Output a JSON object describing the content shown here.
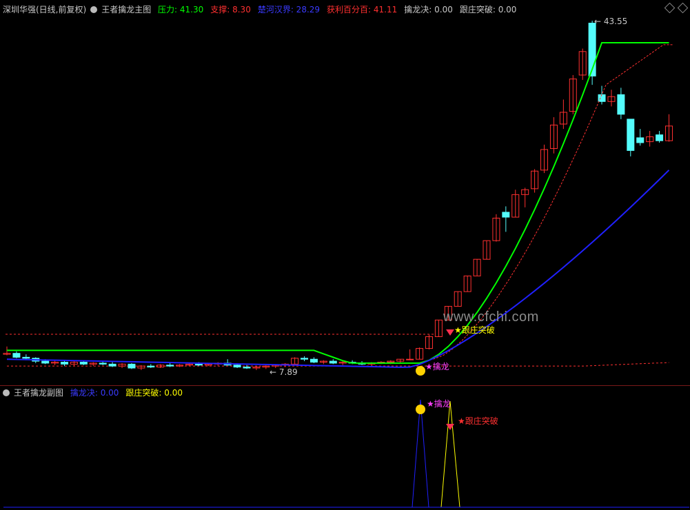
{
  "main_panel": {
    "symbol_title": "深圳华强(日线,前复权)",
    "indicator_name": "王者擒龙主图",
    "readouts": [
      {
        "label": "压力",
        "value": "41.30",
        "color": "#00ff00"
      },
      {
        "label": "支撑",
        "value": "8.30",
        "color": "#ff3030"
      },
      {
        "label": "楚河汉界",
        "value": "28.29",
        "color": "#3a3aff"
      },
      {
        "label": "获利百分百",
        "value": "41.11",
        "color": "#ff3030"
      },
      {
        "label": "擒龙决",
        "value": "0.00",
        "color": "#c8c8c8"
      },
      {
        "label": "跟庄突破",
        "value": "0.00",
        "color": "#c8c8c8"
      }
    ],
    "high_marker": "43.55",
    "low_marker": "7.89",
    "signal_qinlong": "★擒龙",
    "signal_breakout": "★跟庄突破"
  },
  "sub_panel": {
    "indicator_name": "王者擒龙副图",
    "readouts": [
      {
        "label": "擒龙决",
        "value": "0.00",
        "color": "#3a3aff"
      },
      {
        "label": "跟庄突破",
        "value": "0.00",
        "color": "#ffff00"
      }
    ],
    "signal_qinlong": "★擒龙",
    "signal_breakout": "★跟庄突破"
  },
  "watermark": "www.cfchi.com",
  "colors": {
    "up": "#ff3030",
    "down": "#54fcfc",
    "pressure": "#00ff00",
    "support": "#ff3030",
    "boundary": "#2020ff",
    "profit": "#ff3030"
  },
  "chart_data": {
    "type": "candlestick",
    "price_range": [
      7.89,
      43.55
    ],
    "candles_ohlc": [
      [
        9.5,
        10.3,
        9.4,
        9.6
      ],
      [
        9.6,
        9.8,
        9.1,
        9.2
      ],
      [
        9.2,
        9.5,
        8.9,
        9.1
      ],
      [
        9.1,
        9.2,
        8.6,
        8.8
      ],
      [
        8.8,
        9.0,
        8.5,
        8.6
      ],
      [
        8.6,
        8.9,
        8.4,
        8.7
      ],
      [
        8.7,
        8.9,
        8.3,
        8.5
      ],
      [
        8.5,
        8.8,
        8.3,
        8.7
      ],
      [
        8.7,
        8.8,
        8.4,
        8.5
      ],
      [
        8.5,
        8.7,
        8.3,
        8.6
      ],
      [
        8.6,
        8.8,
        8.4,
        8.5
      ],
      [
        8.5,
        8.7,
        8.2,
        8.3
      ],
      [
        8.3,
        8.6,
        8.1,
        8.5
      ],
      [
        8.5,
        8.6,
        8.0,
        8.1
      ],
      [
        8.1,
        8.4,
        7.9,
        8.3
      ],
      [
        8.3,
        8.5,
        8.1,
        8.2
      ],
      [
        8.2,
        8.5,
        8.1,
        8.4
      ],
      [
        8.4,
        8.6,
        8.2,
        8.3
      ],
      [
        8.3,
        8.5,
        8.2,
        8.4
      ],
      [
        8.4,
        8.6,
        8.3,
        8.5
      ],
      [
        8.5,
        8.7,
        8.3,
        8.4
      ],
      [
        8.4,
        8.6,
        8.3,
        8.5
      ],
      [
        8.5,
        8.7,
        8.3,
        8.6
      ],
      [
        8.6,
        9.0,
        8.4,
        8.4
      ],
      [
        8.4,
        8.6,
        8.1,
        8.2
      ],
      [
        8.2,
        8.4,
        8.0,
        8.1
      ],
      [
        8.1,
        8.3,
        7.89,
        8.2
      ],
      [
        8.2,
        8.4,
        8.0,
        8.3
      ],
      [
        8.3,
        8.5,
        8.1,
        8.4
      ],
      [
        8.4,
        8.6,
        8.2,
        8.5
      ],
      [
        8.5,
        9.2,
        8.4,
        9.1
      ],
      [
        9.1,
        9.3,
        8.8,
        9.0
      ],
      [
        9.0,
        9.2,
        8.6,
        8.7
      ],
      [
        8.7,
        8.9,
        8.5,
        8.8
      ],
      [
        8.8,
        9.0,
        8.5,
        8.6
      ],
      [
        8.6,
        8.8,
        8.4,
        8.7
      ],
      [
        8.7,
        8.9,
        8.5,
        8.6
      ],
      [
        8.6,
        8.8,
        8.4,
        8.5
      ],
      [
        8.5,
        8.7,
        8.3,
        8.6
      ],
      [
        8.6,
        8.8,
        8.5,
        8.7
      ],
      [
        8.7,
        8.9,
        8.5,
        8.8
      ],
      [
        8.8,
        9.0,
        8.6,
        9.0
      ],
      [
        9.0,
        10.0,
        8.9,
        9.0
      ],
      [
        9.0,
        10.2,
        9.0,
        10.1
      ],
      [
        10.1,
        11.5,
        10.0,
        11.3
      ],
      [
        11.3,
        13.0,
        11.3,
        13.0
      ],
      [
        13.0,
        14.4,
        13.0,
        14.4
      ],
      [
        14.4,
        15.9,
        14.4,
        15.9
      ],
      [
        15.9,
        17.5,
        15.9,
        17.5
      ],
      [
        17.5,
        19.2,
        17.5,
        19.2
      ],
      [
        19.2,
        21.1,
        19.2,
        21.1
      ],
      [
        21.1,
        23.8,
        21.0,
        23.4
      ],
      [
        24.0,
        24.6,
        22.0,
        23.5
      ],
      [
        23.5,
        26.3,
        23.5,
        25.8
      ],
      [
        25.8,
        26.5,
        24.5,
        26.3
      ],
      [
        26.4,
        28.4,
        26.0,
        28.2
      ],
      [
        28.3,
        30.9,
        28.0,
        30.4
      ],
      [
        30.5,
        33.7,
        30.0,
        32.9
      ],
      [
        33.0,
        35.5,
        32.5,
        34.2
      ],
      [
        34.3,
        38.0,
        34.0,
        37.6
      ],
      [
        38.0,
        40.7,
        37.5,
        40.4
      ],
      [
        43.3,
        43.55,
        37.0,
        37.9
      ],
      [
        36.0,
        36.9,
        35.0,
        35.3
      ],
      [
        35.3,
        36.5,
        34.8,
        35.8
      ],
      [
        36.0,
        36.7,
        33.5,
        34.0
      ],
      [
        33.5,
        33.5,
        29.7,
        30.3
      ],
      [
        31.6,
        32.5,
        30.8,
        31.1
      ],
      [
        31.2,
        32.3,
        30.7,
        31.7
      ],
      [
        31.9,
        32.3,
        31.1,
        31.3
      ],
      [
        31.3,
        34.0,
        31.2,
        32.8
      ]
    ],
    "signals": [
      "擒龙",
      "跟庄突破"
    ]
  }
}
